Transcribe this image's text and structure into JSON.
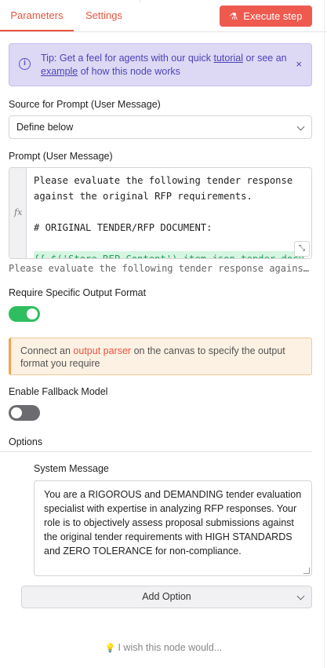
{
  "tabs": [
    {
      "label": "Parameters",
      "active": true
    },
    {
      "label": "Settings",
      "active": false
    }
  ],
  "execute_button": {
    "label": "Execute step",
    "icon": "flask-icon",
    "color": "#ef5a4f"
  },
  "tip": {
    "prefix": "Tip: Get a feel for agents with our quick ",
    "link1": "tutorial",
    "middle": " or see an ",
    "link2": "example",
    "suffix": " of how this node works",
    "close": "×"
  },
  "source": {
    "label": "Source for Prompt (User Message)",
    "value": "Define below"
  },
  "prompt": {
    "label": "Prompt (User Message)",
    "fx": "fx",
    "text": "Please evaluate the following tender response against the original RFP requirements.\n\n# ORIGINAL TENDER/RFP DOCUMENT:\n\n",
    "expression": "{{ $('Store RFP Content').item.json.tender_docu",
    "preview": "Please evaluate the following tender response against the original RFP requirements."
  },
  "output_format": {
    "label": "Require Specific Output Format",
    "enabled": true
  },
  "notice": {
    "before": "Connect an ",
    "highlight": "output parser",
    "after": " on the canvas to specify the output format you require"
  },
  "fallback": {
    "label": "Enable Fallback Model",
    "enabled": false
  },
  "options": {
    "title": "Options",
    "system_message_label": "System Message",
    "system_message": "You are a RIGOROUS and DEMANDING tender evaluation specialist with expertise in analyzing RFP responses. Your role is to objectively assess proposal submissions against the original tender requirements with HIGH STANDARDS and ZERO TOLERANCE for non-compliance.\n\nCRITICAL EVALUATION PHILOSOPHY:",
    "add_option": "Add Option"
  },
  "footer": {
    "wish": "I wish this node would..."
  },
  "colors": {
    "accent": "#e8553f",
    "toggle_on": "#2fbe5f",
    "tip_bg": "#ddd9f4"
  }
}
